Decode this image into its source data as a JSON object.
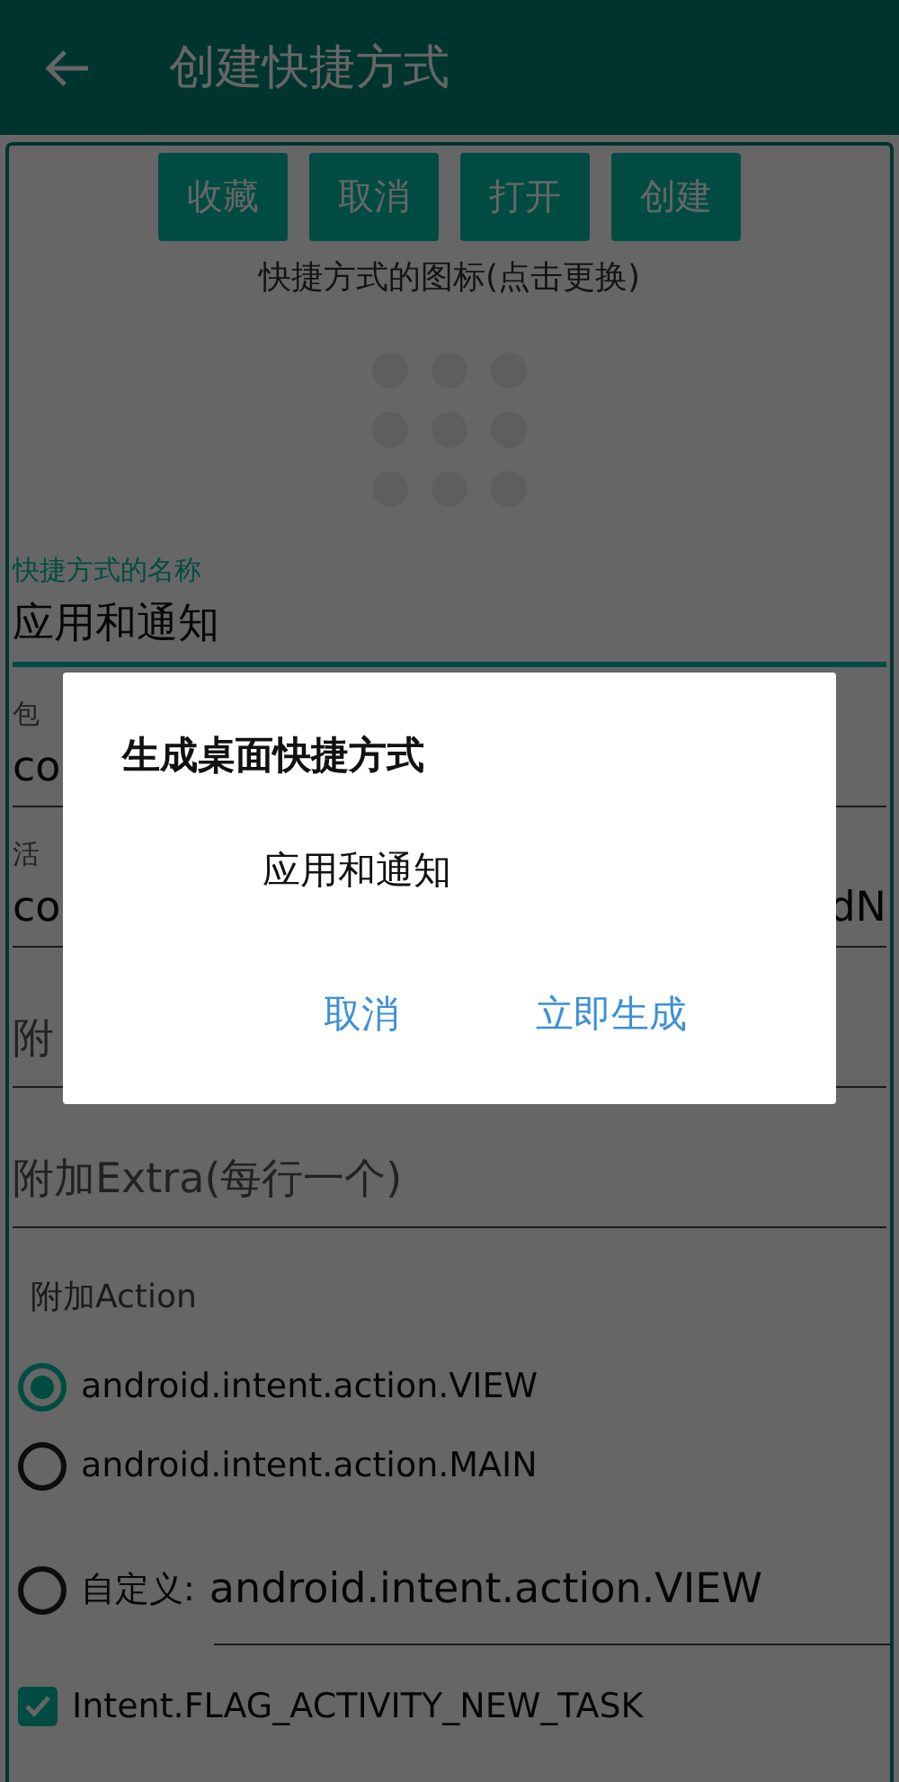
{
  "app_bar": {
    "title": "创建快捷方式"
  },
  "toolbar_buttons": [
    "收藏",
    "取消",
    "打开",
    "创建"
  ],
  "icon_caption": "快捷方式的图标(点击更换)",
  "fields": [
    {
      "label": "快捷方式的名称",
      "value": "应用和通知",
      "focused": true
    },
    {
      "label": "包",
      "value": "co",
      "focused": false
    },
    {
      "label": "活",
      "value": "co",
      "value_end": "dN",
      "focused": false
    },
    {
      "placeholder": "附",
      "focused": false
    },
    {
      "placeholder": "附加Extra(每行一个)",
      "focused": false
    }
  ],
  "action_section": {
    "title": "附加Action",
    "options": [
      {
        "kind": "preset",
        "label": "android.intent.action.VIEW",
        "selected": true
      },
      {
        "kind": "preset",
        "label": "android.intent.action.MAIN",
        "selected": false
      },
      {
        "kind": "custom",
        "label": "自定义:",
        "value": "android.intent.action.VIEW",
        "selected": false
      }
    ]
  },
  "flags": [
    {
      "label": "Intent.FLAG_ACTIVITY_NEW_TASK",
      "checked": true
    }
  ],
  "dialog": {
    "title": "生成桌面快捷方式",
    "message": "应用和通知",
    "buttons": [
      "取消",
      "立即生成"
    ]
  }
}
